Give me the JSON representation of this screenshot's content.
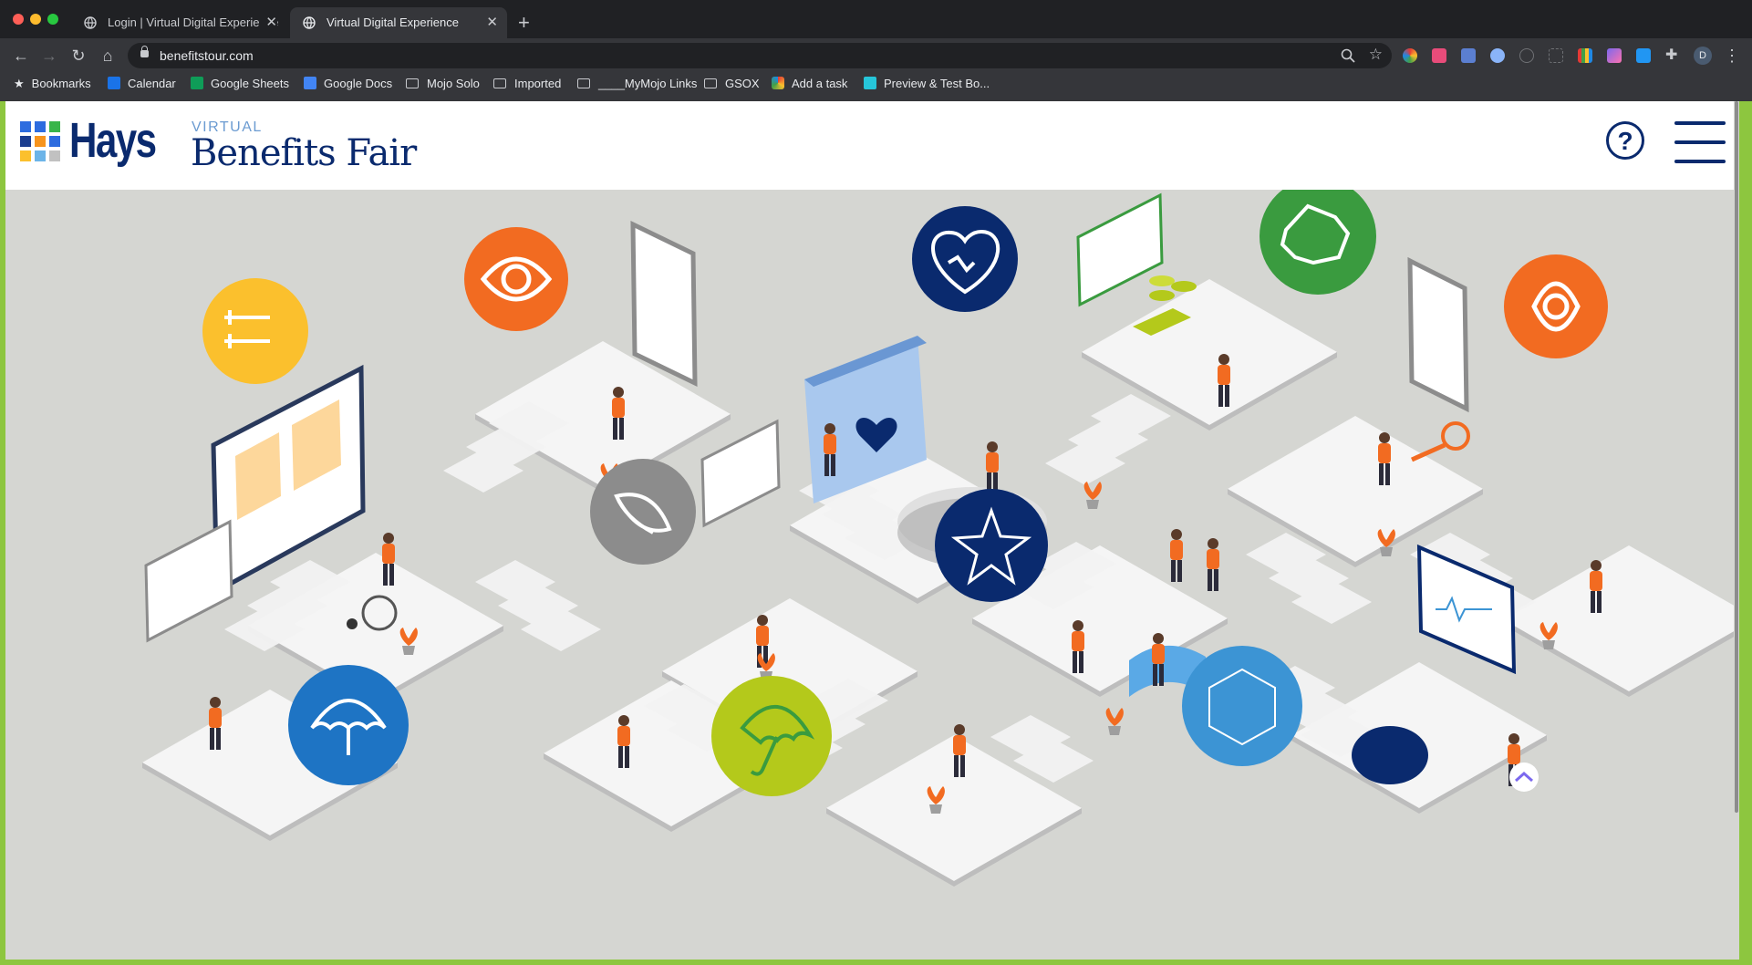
{
  "browser": {
    "tabs": [
      {
        "title": "Login | Virtual Digital Experience",
        "active": false
      },
      {
        "title": "Virtual Digital Experience",
        "active": true
      }
    ],
    "new_tab_icon": "plus-icon",
    "url": "benefitstour.com",
    "profile_initial": "D",
    "bookmarks": [
      {
        "label": "Bookmarks",
        "icon": "star-icon"
      },
      {
        "label": "Calendar",
        "icon": "calendar-icon"
      },
      {
        "label": "Google Sheets",
        "icon": "sheets-icon"
      },
      {
        "label": "Google Docs",
        "icon": "docs-icon"
      },
      {
        "label": "Mojo Solo",
        "icon": "folder-icon"
      },
      {
        "label": "Imported",
        "icon": "folder-icon"
      },
      {
        "label": "____MyMojo Links",
        "icon": "folder-icon"
      },
      {
        "label": "GSOX",
        "icon": "folder-icon"
      },
      {
        "label": "Add a task",
        "icon": "task-icon"
      },
      {
        "label": "Preview & Test Bo...",
        "icon": "preview-icon"
      }
    ]
  },
  "site": {
    "logo_text": "Hays",
    "tag": "VIRTUAL",
    "title": "Benefits Fair",
    "help_label": "?",
    "brand_color": "#0a2a6e"
  },
  "booths": [
    {
      "icon": "crutches-icon",
      "color": "#fbc02d"
    },
    {
      "icon": "eye-icon",
      "color": "#f26b21"
    },
    {
      "icon": "heart-pulse-icon",
      "color": "#0a2a6e"
    },
    {
      "icon": "map-icon",
      "color": "#3a9b3f"
    },
    {
      "icon": "eye-icon",
      "color": "#f26b21"
    },
    {
      "icon": "shield-slice-icon",
      "color": "#8c8c8c"
    },
    {
      "icon": "star-icon",
      "color": "#0a2a6e"
    },
    {
      "icon": "umbrella-icon",
      "color": "#1e74c4"
    },
    {
      "icon": "umbrella-icon",
      "color": "#b4c91b"
    },
    {
      "icon": "hexagon-icon",
      "color": "#3c94d4"
    }
  ]
}
